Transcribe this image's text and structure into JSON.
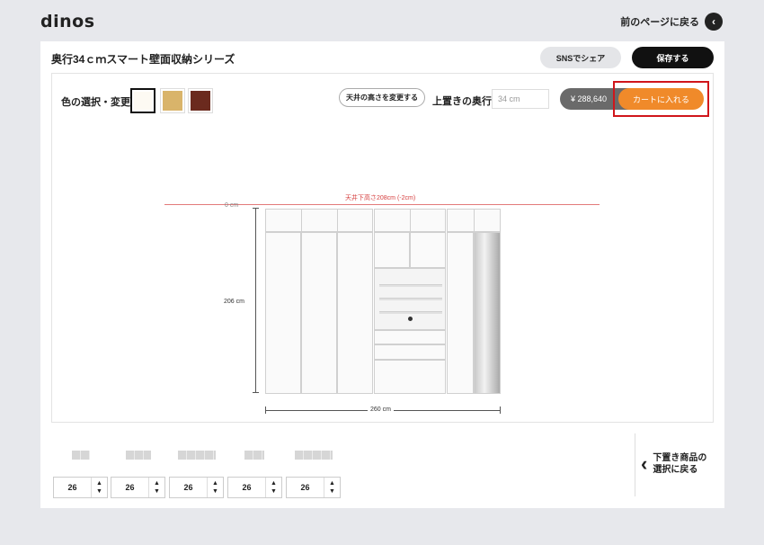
{
  "header": {
    "logo": "dinos",
    "back_label": "前のページに戻る",
    "back_icon": "‹"
  },
  "product": {
    "title": "奥行34ｃｍスマート壁面収納シリーズ",
    "sns_label": "SNSでシェア",
    "save_label": "保存する"
  },
  "options": {
    "color_label": "色の選択・変更",
    "swatches": [
      {
        "name": "ホワイト",
        "color": "#fdfaf3",
        "selected": true
      },
      {
        "name": "ナチュラル",
        "color": "#d9b46a",
        "selected": false
      },
      {
        "name": "ブラウン",
        "color": "#6b2a1e",
        "selected": false
      }
    ],
    "ceiling_button": "天井の高さを変更する",
    "depth_label": "上置きの奥行",
    "depth_placeholder": "34 cm",
    "price": "¥ 288,640",
    "cart_label": "カートに入れる"
  },
  "drawing": {
    "ceiling_text": "天井下高さ208cm (-2cm)",
    "zero_label": "0 cm",
    "height_label": "206 cm",
    "width_label": "260 cm"
  },
  "modules": [
    {
      "value": "26"
    },
    {
      "value": "26"
    },
    {
      "value": "26"
    },
    {
      "value": "26"
    },
    {
      "value": "26"
    }
  ],
  "stepper_icons": {
    "up": "▲",
    "down": "▼"
  },
  "return_select": {
    "chevron": "‹",
    "line1": "下置き商品の",
    "line2": "選択に戻る"
  }
}
